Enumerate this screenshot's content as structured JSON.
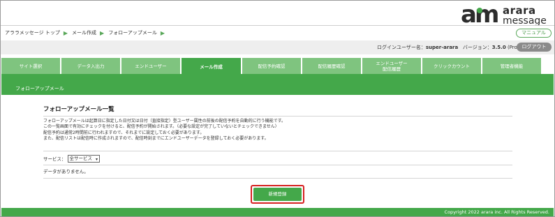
{
  "logo": {
    "mark": "am",
    "top": "arara",
    "bottom": "message"
  },
  "breadcrumb": [
    "アララメッセージ トップ",
    "メール作成",
    "フォローアップメール"
  ],
  "header": {
    "manual_label": "マニュアル",
    "login_label": "ログインユーザー名：",
    "login_user": "super-arara",
    "version_label": "バージョン：",
    "version": "3.5.0",
    "edition": "(Pro)",
    "logout_label": "ログアウト"
  },
  "tabs": [
    {
      "label": "サイト選択",
      "active": false
    },
    {
      "label": "データ入出力",
      "active": false
    },
    {
      "label": "エンドユーザー",
      "active": false
    },
    {
      "label": "メール作成",
      "active": true
    },
    {
      "label": "配信予約確認",
      "active": false
    },
    {
      "label": "配信履歴確認",
      "active": false
    },
    {
      "label_line1": "エンドユーザー",
      "label_line2": "配信履歴",
      "active": false
    },
    {
      "label": "クリックカウント",
      "active": false
    },
    {
      "label": "管理者機能",
      "active": false
    }
  ],
  "section": {
    "title": "フォローアップメール"
  },
  "panel": {
    "title": "フォローアップメール一覧",
    "description": [
      "フォローアップメールは起算日に指定した日付又は日付（直接指定）型ユーザー属性の前後の配信予約を自動的に行う機能です。",
      "この一覧画面で有効にチェックを付けると、配信予約が開始されます。（必要な設定が完了していないとチェックできません）",
      "配信予約は通常2時間前に行われますので、それまでに設定しておく必要があります。",
      "また、配信リストは配信時に作成されますので、配信時刻までにエンドユーザーデータを登録しておく必要があります。"
    ],
    "service_label": "サービス：",
    "service_value": "全サービス",
    "no_data": "データがありません。",
    "register_label": "新規登録"
  },
  "footer": {
    "copyright": "Copyright 2022 arara inc. All Rights Reserved."
  },
  "colors": {
    "brand_green": "#44a84a",
    "tab_green": "#7fc47f",
    "highlight_red": "#d62020"
  }
}
